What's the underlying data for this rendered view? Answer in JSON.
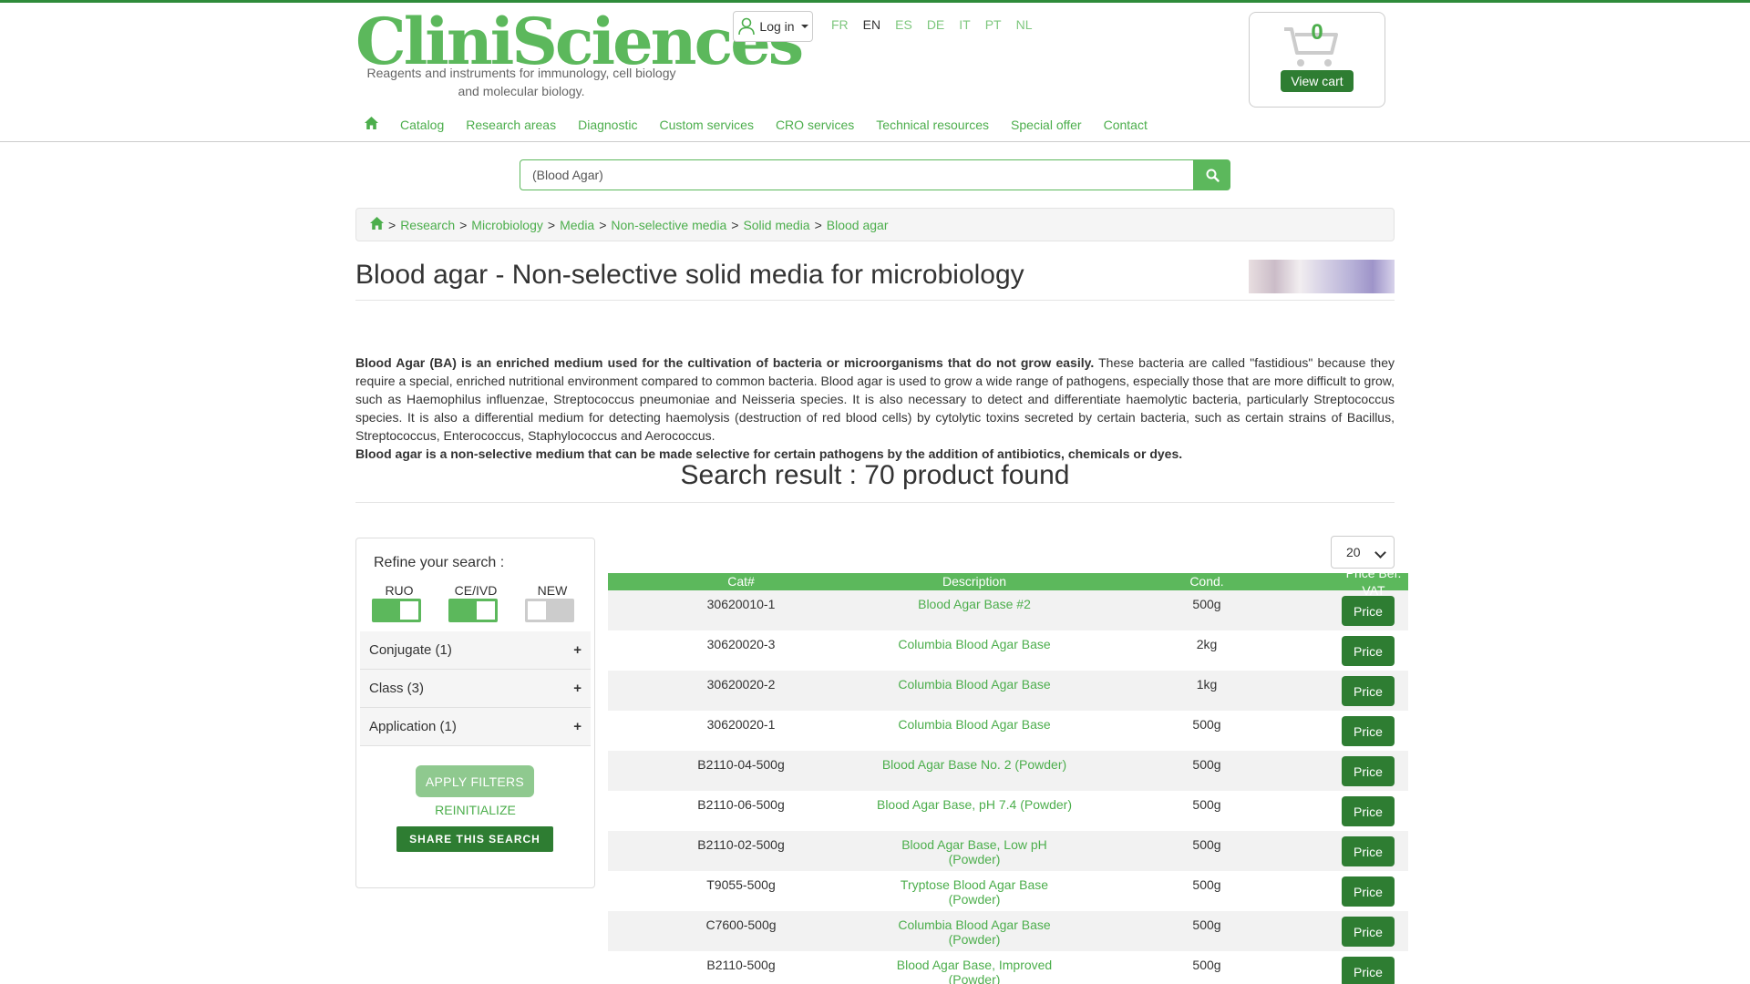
{
  "header": {
    "logo": "CliniSciences",
    "tagline": "Reagents and instruments for immunology, cell biology and molecular biology.",
    "login_label": "Log in",
    "languages": [
      "FR",
      "EN",
      "ES",
      "DE",
      "IT",
      "PT",
      "NL"
    ],
    "active_language": "EN",
    "cart_count": "0",
    "cart_button": "View cart"
  },
  "nav": {
    "items": [
      "Catalog",
      "Research areas",
      "Diagnostic",
      "Custom services",
      "CRO services",
      "Technical resources",
      "Special offer",
      "Contact"
    ]
  },
  "search": {
    "value": "(Blood Agar)"
  },
  "breadcrumb": {
    "items": [
      "Research",
      "Microbiology",
      "Media",
      "Non-selective media",
      "Solid media",
      "Blood agar"
    ]
  },
  "page": {
    "title": "Blood agar - Non-selective solid media for microbiology",
    "intro_bold": "Blood Agar (BA) is an enriched medium used for the cultivation of bacteria or microorganisms that do not grow easily.",
    "intro_text": "These bacteria are called \"fastidious\" because they require a special, enriched nutritional environment compared to common bacteria. Blood agar is used to grow a wide range of pathogens, especially those that are more difficult to grow, such as Haemophilus influenzae, Streptococcus pneumoniae and Neisseria species. It is also necessary to detect and differentiate haemolytic bacteria, particularly Streptococcus species. It is also a differential medium for detecting haemolysis (destruction of red blood cells) by cytolytic toxins secreted by certain bacteria, such as certain strains of Bacillus, Streptococcus, Enterococcus, Staphylococcus and Aerococcus.",
    "intro_bold2": "Blood agar is a non-selective medium that can be made selective for certain pathogens by the addition of antibiotics, chemicals or dyes.",
    "result_title": "Search result : 70 product found"
  },
  "filters": {
    "title": "Refine your search :",
    "toggles": [
      {
        "label": "RUO",
        "state": "on"
      },
      {
        "label": "CE/IVD",
        "state": "on"
      },
      {
        "label": "NEW",
        "state": "off"
      }
    ],
    "facets": [
      "Conjugate (1)",
      "Class (3)",
      "Application (1)"
    ],
    "facet_toggle": "+",
    "apply_label": "APPLY FILTERS",
    "reinit_label": "REINITIALIZE",
    "share_label": "SHARE THIS SEARCH"
  },
  "results": {
    "per_page": "20",
    "columns": [
      "Cat#",
      "Description",
      "Cond.",
      "Price Bef. VAT"
    ],
    "price_label": "Price",
    "rows": [
      {
        "cat": "30620010-1",
        "desc": "Blood Agar Base #2",
        "cond": "500g"
      },
      {
        "cat": "30620020-3",
        "desc": "Columbia Blood Agar Base",
        "cond": "2kg"
      },
      {
        "cat": "30620020-2",
        "desc": "Columbia Blood Agar Base",
        "cond": "1kg"
      },
      {
        "cat": "30620020-1",
        "desc": "Columbia Blood Agar Base",
        "cond": "500g"
      },
      {
        "cat": "B2110-04-500g",
        "desc": "Blood Agar Base No. 2 (Powder)",
        "cond": "500g"
      },
      {
        "cat": "B2110-06-500g",
        "desc": "Blood Agar Base, pH 7.4 (Powder)",
        "cond": "500g"
      },
      {
        "cat": "B2110-02-500g",
        "desc": "Blood Agar Base, Low pH (Powder)",
        "cond": "500g"
      },
      {
        "cat": "T9055-500g",
        "desc": "Tryptose Blood Agar Base (Powder)",
        "cond": "500g"
      },
      {
        "cat": "C7600-500g",
        "desc": "Columbia Blood Agar Base (Powder)",
        "cond": "500g"
      },
      {
        "cat": "B2110-500g",
        "desc": "Blood Agar Base, Improved (Powder)",
        "cond": "500g"
      }
    ]
  },
  "colors": {
    "brand_green": "#5cb85c",
    "dark_green": "#2e7d32",
    "link_green": "#4cae4c"
  }
}
